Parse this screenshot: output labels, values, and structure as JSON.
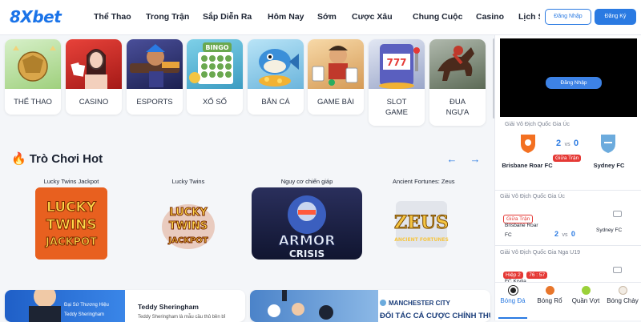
{
  "brand": {
    "logo": "8Xbet"
  },
  "nav": {
    "items": [
      "Thể Thao",
      "Trong Trận",
      "Sắp Diễn Ra",
      "Hôm Nay",
      "Sớm",
      "Cược Xâu",
      "Chung Cuộc",
      "Casino",
      "Lịch S"
    ]
  },
  "auth": {
    "login": "Đăng Nhập",
    "register": "Đăng Ký"
  },
  "categories": [
    {
      "label": "THỂ THAO",
      "icon": "soccer-ball-icon"
    },
    {
      "label": "CASINO",
      "icon": "casino-dealer-icon"
    },
    {
      "label": "ESPORTS",
      "icon": "esports-character-icon"
    },
    {
      "label": "XỔ SỐ",
      "icon": "bingo-card-icon"
    },
    {
      "label": "BẮN CÁ",
      "icon": "fish-icon"
    },
    {
      "label": "GAME BÀI",
      "icon": "card-game-icon"
    },
    {
      "label": "SLOT GAME",
      "label_line1": "SLOT",
      "label_line2": "GAME",
      "icon": "slot-machine-icon"
    },
    {
      "label": "ĐUA NGỰA",
      "label_line1": "ĐUA",
      "label_line2": "NGỰA",
      "icon": "horse-racing-icon"
    }
  ],
  "hot_games": {
    "title": "Trò Chơi Hot",
    "games": [
      {
        "name": "Lucky Twins Jackpot",
        "art_line1": "LUCKY",
        "art_line2": "TWINS",
        "art_line3": "JACKPOT"
      },
      {
        "name": "Lucky Twins",
        "art_line1": "LUCKY",
        "art_line2": "TWINS",
        "art_line3": "JACKPOT"
      },
      {
        "name": "Nguy cơ chiến giáp",
        "art_line1": "ARMOR",
        "art_line2": "CRISIS"
      },
      {
        "name": "Ancient Fortunes: Zeus",
        "art_line1": "ZEUS",
        "art_line2": "ANCIENT FORTUNES"
      }
    ]
  },
  "banners": {
    "left": {
      "tag": "Đại Sứ Thương Hiệu",
      "tag_name": "Teddy Sheringham",
      "title": "Teddy Sheringham",
      "text": "Teddy Sheringham là mẫu cầu thủ bền bỉ"
    },
    "right": {
      "club": "MANCHESTER CITY",
      "title": "ĐỐI TÁC CÁ CƯỢC CHÍNH THỨC"
    }
  },
  "right_panel": {
    "video_login": "Đăng Nhập",
    "featured": {
      "league": "Giải Vô Địch Quốc Gia Úc",
      "home": "Brisbane Roar FC",
      "away": "Sydney FC",
      "home_score": "2",
      "vs": "vs",
      "away_score": "0",
      "status": "Giữa Trận"
    },
    "matches": [
      {
        "league": "Giải Vô Địch Quốc Gia Úc",
        "status": "Giữa Trận",
        "home": "Brisbane Roar",
        "home2": "FC",
        "home_score": "2",
        "vs": "vs",
        "away_score": "0",
        "away": "Sydney FC"
      },
      {
        "league": "Giải Vô Địch Quốc Gia Nga U19",
        "status": "Hiệp 2",
        "time": "76 : 57",
        "home": "FC Krylia"
      }
    ],
    "sports": [
      "Bóng Đá",
      "Bóng Rổ",
      "Quần Vợt",
      "Bóng Chày"
    ]
  },
  "colors": {
    "primary": "#2a7ae2",
    "live": "#e53935",
    "accent_fire": "#f04a1b"
  }
}
